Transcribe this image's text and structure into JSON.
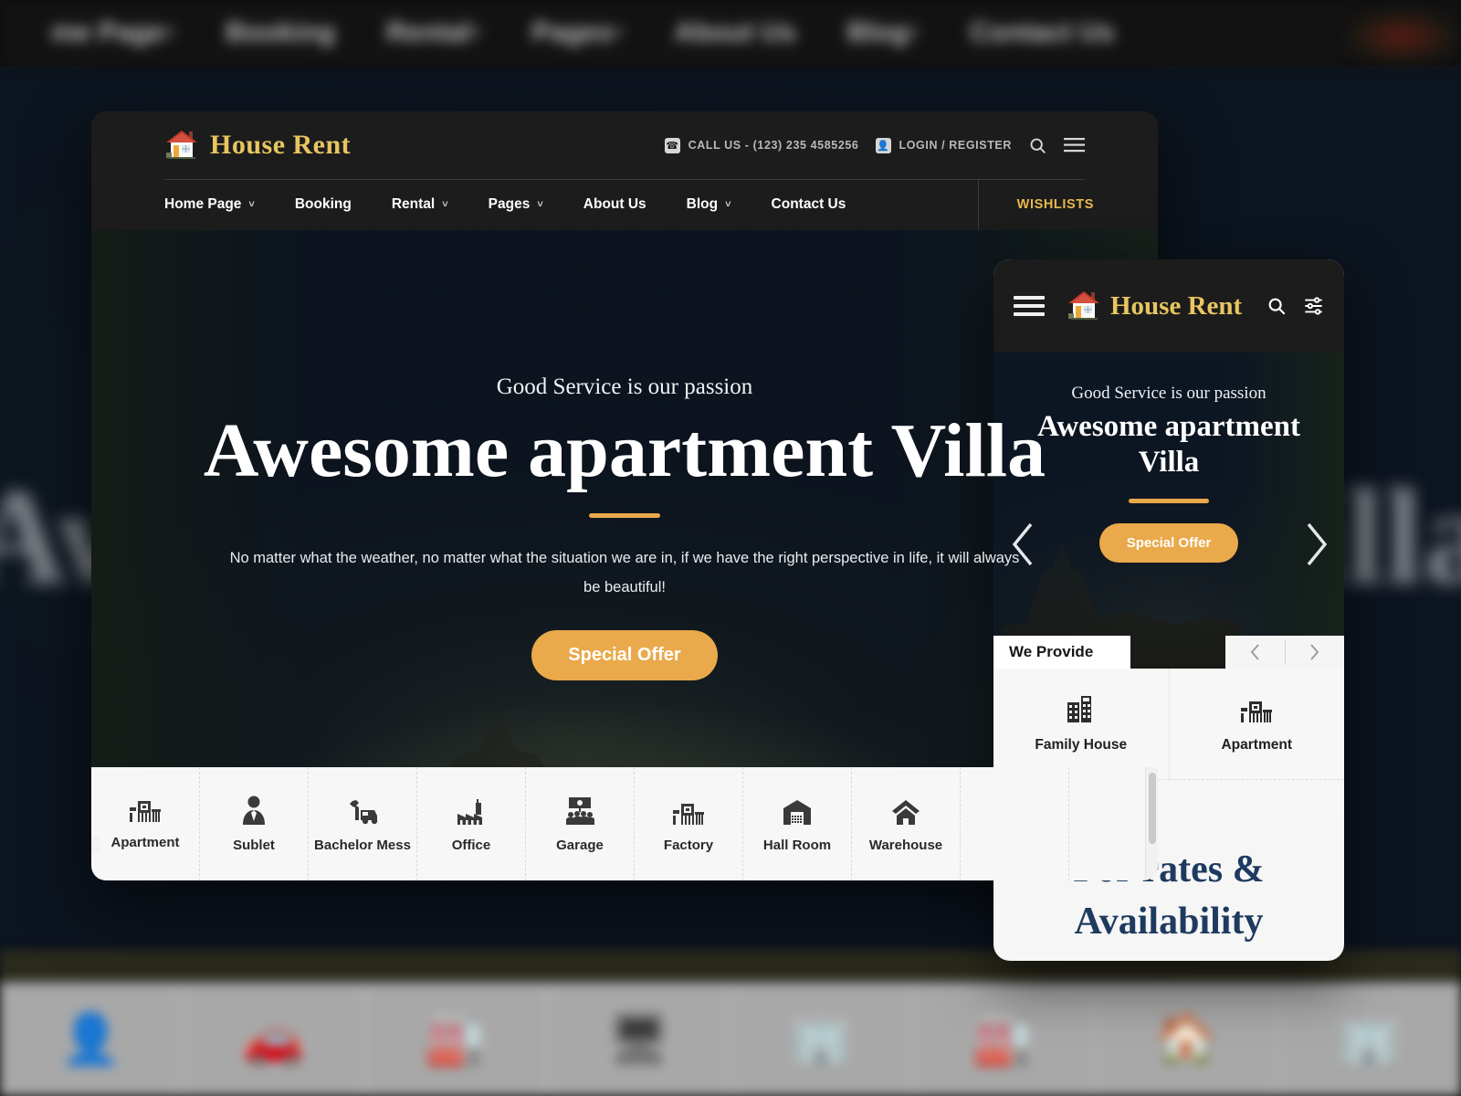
{
  "background": {
    "nav_items": [
      "me Page",
      "Booking",
      "Rental",
      "Pages",
      "About Us",
      "Blog",
      "Contact Us"
    ],
    "big_title": "Awesome apartment Villa",
    "sub_text": "No matter what the weather, no matter what the situation we are in, if we"
  },
  "desktop": {
    "brand": {
      "name": "House Rent",
      "logo_icon": "house-icon"
    },
    "header": {
      "phone_icon": "phone-icon",
      "phone_text": "CALL US - (123) 235 4585256",
      "account_icon": "user-card-icon",
      "account_text": "LOGIN / REGISTER",
      "search_icon": "search-icon",
      "menu_icon": "hamburger-menu-icon"
    },
    "nav": {
      "items": [
        {
          "label": "Home Page",
          "has_caret": true
        },
        {
          "label": "Booking",
          "has_caret": false
        },
        {
          "label": "Rental",
          "has_caret": true
        },
        {
          "label": "Pages",
          "has_caret": true
        },
        {
          "label": "About Us",
          "has_caret": false
        },
        {
          "label": "Blog",
          "has_caret": true
        },
        {
          "label": "Contact Us",
          "has_caret": false
        }
      ],
      "wishlists_label": "WISHLISTS"
    },
    "hero": {
      "eyebrow": "Good Service is our passion",
      "title": "Awesome apartment Villa",
      "description": "No matter what the weather, no matter what the situation we are in, if we have the right perspective in life, it will always be beautiful!",
      "cta_label": "Special Offer"
    },
    "categories": [
      {
        "label": "Apartment",
        "icon": "apartment-building-icon"
      },
      {
        "label": "Sublet",
        "icon": "person-tie-icon"
      },
      {
        "label": "Bachelor Mess",
        "icon": "wrench-car-icon"
      },
      {
        "label": "Office",
        "icon": "factory-icon"
      },
      {
        "label": "Garage",
        "icon": "conference-screen-icon"
      },
      {
        "label": "Factory",
        "icon": "apartment-building-icon"
      },
      {
        "label": "Hall Room",
        "icon": "warehouse-icon"
      },
      {
        "label": "Warehouse",
        "icon": "home-icon"
      }
    ]
  },
  "mobile": {
    "brand": {
      "name": "House Rent",
      "logo_icon": "house-icon"
    },
    "header": {
      "menu_icon": "hamburger-menu-icon",
      "search_icon": "search-icon",
      "filter_icon": "sliders-filter-icon"
    },
    "hero": {
      "eyebrow": "Good Service is our passion",
      "title": "Awesome apartment Villa",
      "cta_label": "Special Offer",
      "prev_icon": "chevron-left-icon",
      "next_icon": "chevron-right-icon"
    },
    "provide": {
      "heading": "We Provide",
      "prev_icon": "chevron-left-icon",
      "next_icon": "chevron-right-icon",
      "items": [
        {
          "label": "Family House",
          "icon": "city-buildings-icon"
        },
        {
          "label": "Apartment",
          "icon": "apartment-building-icon"
        }
      ]
    },
    "rates_heading": "For rates & Availability"
  },
  "colors": {
    "accent_gold": "#e8c560",
    "accent_orange": "#eaa94a",
    "header_dark": "#1c1c1c",
    "panel_light": "#f7f7f7",
    "rates_navy": "#1e3a5f"
  }
}
